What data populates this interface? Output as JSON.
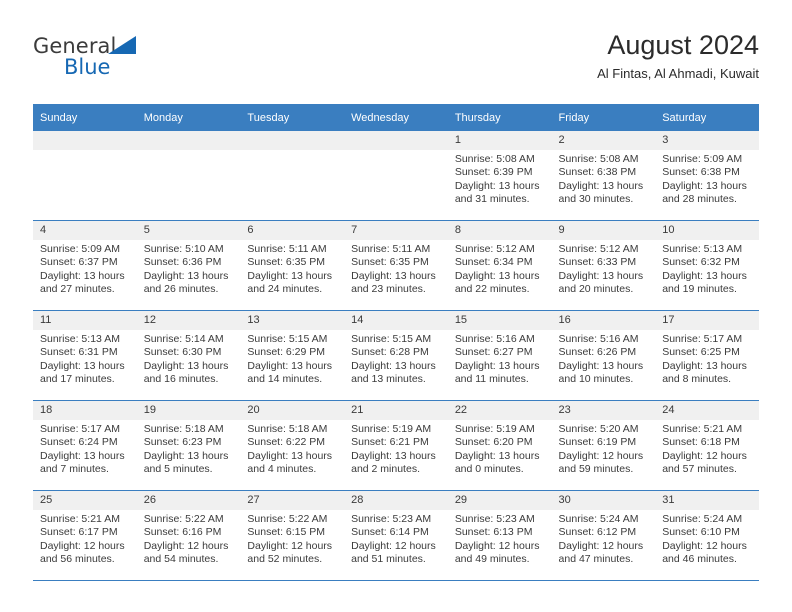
{
  "brand": {
    "name_part1": "General",
    "name_part2": "Blue",
    "accent_color": "#1668b3"
  },
  "header": {
    "title": "August 2024",
    "subtitle": "Al Fintas, Al Ahmadi, Kuwait"
  },
  "calendar": {
    "header_color": "#3a7ec0",
    "weekday_headers": [
      "Sunday",
      "Monday",
      "Tuesday",
      "Wednesday",
      "Thursday",
      "Friday",
      "Saturday"
    ],
    "labels": {
      "sunrise": "Sunrise:",
      "sunset": "Sunset:",
      "daylight": "Daylight:"
    },
    "weeks": [
      [
        {
          "day": "",
          "empty": true
        },
        {
          "day": "",
          "empty": true
        },
        {
          "day": "",
          "empty": true
        },
        {
          "day": "",
          "empty": true
        },
        {
          "day": "1",
          "sunrise": "Sunrise: 5:08 AM",
          "sunset": "Sunset: 6:39 PM",
          "daylight_1": "Daylight: 13 hours",
          "daylight_2": "and 31 minutes."
        },
        {
          "day": "2",
          "sunrise": "Sunrise: 5:08 AM",
          "sunset": "Sunset: 6:38 PM",
          "daylight_1": "Daylight: 13 hours",
          "daylight_2": "and 30 minutes."
        },
        {
          "day": "3",
          "sunrise": "Sunrise: 5:09 AM",
          "sunset": "Sunset: 6:38 PM",
          "daylight_1": "Daylight: 13 hours",
          "daylight_2": "and 28 minutes."
        }
      ],
      [
        {
          "day": "4",
          "sunrise": "Sunrise: 5:09 AM",
          "sunset": "Sunset: 6:37 PM",
          "daylight_1": "Daylight: 13 hours",
          "daylight_2": "and 27 minutes."
        },
        {
          "day": "5",
          "sunrise": "Sunrise: 5:10 AM",
          "sunset": "Sunset: 6:36 PM",
          "daylight_1": "Daylight: 13 hours",
          "daylight_2": "and 26 minutes."
        },
        {
          "day": "6",
          "sunrise": "Sunrise: 5:11 AM",
          "sunset": "Sunset: 6:35 PM",
          "daylight_1": "Daylight: 13 hours",
          "daylight_2": "and 24 minutes."
        },
        {
          "day": "7",
          "sunrise": "Sunrise: 5:11 AM",
          "sunset": "Sunset: 6:35 PM",
          "daylight_1": "Daylight: 13 hours",
          "daylight_2": "and 23 minutes."
        },
        {
          "day": "8",
          "sunrise": "Sunrise: 5:12 AM",
          "sunset": "Sunset: 6:34 PM",
          "daylight_1": "Daylight: 13 hours",
          "daylight_2": "and 22 minutes."
        },
        {
          "day": "9",
          "sunrise": "Sunrise: 5:12 AM",
          "sunset": "Sunset: 6:33 PM",
          "daylight_1": "Daylight: 13 hours",
          "daylight_2": "and 20 minutes."
        },
        {
          "day": "10",
          "sunrise": "Sunrise: 5:13 AM",
          "sunset": "Sunset: 6:32 PM",
          "daylight_1": "Daylight: 13 hours",
          "daylight_2": "and 19 minutes."
        }
      ],
      [
        {
          "day": "11",
          "sunrise": "Sunrise: 5:13 AM",
          "sunset": "Sunset: 6:31 PM",
          "daylight_1": "Daylight: 13 hours",
          "daylight_2": "and 17 minutes."
        },
        {
          "day": "12",
          "sunrise": "Sunrise: 5:14 AM",
          "sunset": "Sunset: 6:30 PM",
          "daylight_1": "Daylight: 13 hours",
          "daylight_2": "and 16 minutes."
        },
        {
          "day": "13",
          "sunrise": "Sunrise: 5:15 AM",
          "sunset": "Sunset: 6:29 PM",
          "daylight_1": "Daylight: 13 hours",
          "daylight_2": "and 14 minutes."
        },
        {
          "day": "14",
          "sunrise": "Sunrise: 5:15 AM",
          "sunset": "Sunset: 6:28 PM",
          "daylight_1": "Daylight: 13 hours",
          "daylight_2": "and 13 minutes."
        },
        {
          "day": "15",
          "sunrise": "Sunrise: 5:16 AM",
          "sunset": "Sunset: 6:27 PM",
          "daylight_1": "Daylight: 13 hours",
          "daylight_2": "and 11 minutes."
        },
        {
          "day": "16",
          "sunrise": "Sunrise: 5:16 AM",
          "sunset": "Sunset: 6:26 PM",
          "daylight_1": "Daylight: 13 hours",
          "daylight_2": "and 10 minutes."
        },
        {
          "day": "17",
          "sunrise": "Sunrise: 5:17 AM",
          "sunset": "Sunset: 6:25 PM",
          "daylight_1": "Daylight: 13 hours",
          "daylight_2": "and 8 minutes."
        }
      ],
      [
        {
          "day": "18",
          "sunrise": "Sunrise: 5:17 AM",
          "sunset": "Sunset: 6:24 PM",
          "daylight_1": "Daylight: 13 hours",
          "daylight_2": "and 7 minutes."
        },
        {
          "day": "19",
          "sunrise": "Sunrise: 5:18 AM",
          "sunset": "Sunset: 6:23 PM",
          "daylight_1": "Daylight: 13 hours",
          "daylight_2": "and 5 minutes."
        },
        {
          "day": "20",
          "sunrise": "Sunrise: 5:18 AM",
          "sunset": "Sunset: 6:22 PM",
          "daylight_1": "Daylight: 13 hours",
          "daylight_2": "and 4 minutes."
        },
        {
          "day": "21",
          "sunrise": "Sunrise: 5:19 AM",
          "sunset": "Sunset: 6:21 PM",
          "daylight_1": "Daylight: 13 hours",
          "daylight_2": "and 2 minutes."
        },
        {
          "day": "22",
          "sunrise": "Sunrise: 5:19 AM",
          "sunset": "Sunset: 6:20 PM",
          "daylight_1": "Daylight: 13 hours",
          "daylight_2": "and 0 minutes."
        },
        {
          "day": "23",
          "sunrise": "Sunrise: 5:20 AM",
          "sunset": "Sunset: 6:19 PM",
          "daylight_1": "Daylight: 12 hours",
          "daylight_2": "and 59 minutes."
        },
        {
          "day": "24",
          "sunrise": "Sunrise: 5:21 AM",
          "sunset": "Sunset: 6:18 PM",
          "daylight_1": "Daylight: 12 hours",
          "daylight_2": "and 57 minutes."
        }
      ],
      [
        {
          "day": "25",
          "sunrise": "Sunrise: 5:21 AM",
          "sunset": "Sunset: 6:17 PM",
          "daylight_1": "Daylight: 12 hours",
          "daylight_2": "and 56 minutes."
        },
        {
          "day": "26",
          "sunrise": "Sunrise: 5:22 AM",
          "sunset": "Sunset: 6:16 PM",
          "daylight_1": "Daylight: 12 hours",
          "daylight_2": "and 54 minutes."
        },
        {
          "day": "27",
          "sunrise": "Sunrise: 5:22 AM",
          "sunset": "Sunset: 6:15 PM",
          "daylight_1": "Daylight: 12 hours",
          "daylight_2": "and 52 minutes."
        },
        {
          "day": "28",
          "sunrise": "Sunrise: 5:23 AM",
          "sunset": "Sunset: 6:14 PM",
          "daylight_1": "Daylight: 12 hours",
          "daylight_2": "and 51 minutes."
        },
        {
          "day": "29",
          "sunrise": "Sunrise: 5:23 AM",
          "sunset": "Sunset: 6:13 PM",
          "daylight_1": "Daylight: 12 hours",
          "daylight_2": "and 49 minutes."
        },
        {
          "day": "30",
          "sunrise": "Sunrise: 5:24 AM",
          "sunset": "Sunset: 6:12 PM",
          "daylight_1": "Daylight: 12 hours",
          "daylight_2": "and 47 minutes."
        },
        {
          "day": "31",
          "sunrise": "Sunrise: 5:24 AM",
          "sunset": "Sunset: 6:10 PM",
          "daylight_1": "Daylight: 12 hours",
          "daylight_2": "and 46 minutes."
        }
      ]
    ]
  }
}
